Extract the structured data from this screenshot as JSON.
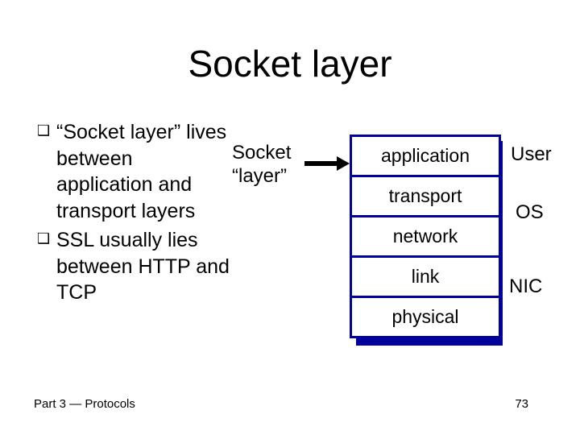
{
  "title": "Socket layer",
  "bullets": [
    "“Socket layer” lives between application and transport layers",
    "SSL usually lies between HTTP and TCP"
  ],
  "socket_label": {
    "line1": "Socket",
    "line2": "“layer”"
  },
  "layers": [
    "application",
    "transport",
    "network",
    "link",
    "physical"
  ],
  "right_labels": [
    "User",
    "OS",
    "NIC"
  ],
  "footer": {
    "left": "Part 3 — Protocols",
    "right": "73"
  }
}
